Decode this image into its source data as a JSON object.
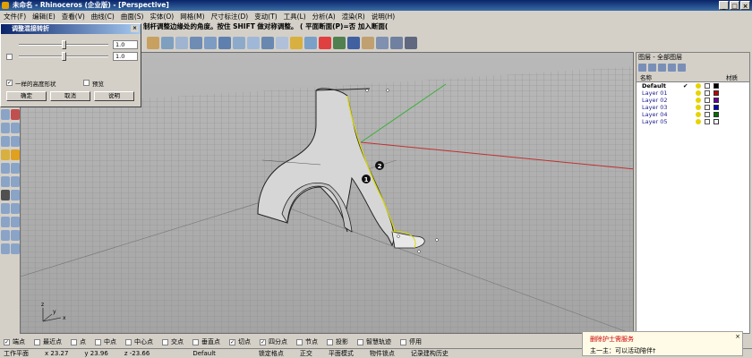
{
  "window": {
    "title": "未命名 - Rhinoceros (企业版) - [Perspective]",
    "buttons": [
      "_",
      "□",
      "×"
    ]
  },
  "menu": {
    "items": [
      "文件(F)",
      "编辑(E)",
      "查看(V)",
      "曲线(C)",
      "曲面(S)",
      "实体(O)",
      "网格(M)",
      "尺寸标注(D)",
      "变动(T)",
      "工具(L)",
      "分析(A)",
      "渲染(R)",
      "说明(H)"
    ]
  },
  "command": {
    "prompt": "制杆调整边缘处的角度。按住 SHIFT 做对称调整。 ( 平面断面(P)=否  加入断面("
  },
  "dialog": {
    "title": "调整混接转折",
    "value1": "1.0",
    "value2": "1.0",
    "same_shape_label": "一样的高度形状",
    "preview_label": "预览",
    "ok_label": "确定",
    "cancel_label": "取消",
    "help_label": "说明",
    "same_shape_checked": true,
    "preview_checked": false
  },
  "viewport": {
    "name": "Perspective",
    "marker1": "1",
    "marker2": "2",
    "axis_x": "x",
    "axis_y": "y",
    "axis_z": "z"
  },
  "layers_panel": {
    "title": "图层 - 全部图层",
    "col_name": "名称",
    "col_material": "材质",
    "rows": [
      {
        "name": "Default",
        "current": "✔",
        "color": "#000000"
      },
      {
        "name": "Layer 01",
        "current": "",
        "color": "#c00000"
      },
      {
        "name": "Layer 02",
        "current": "",
        "color": "#6a00a0"
      },
      {
        "name": "Layer 03",
        "current": "",
        "color": "#0000c0"
      },
      {
        "name": "Layer 04",
        "current": "",
        "color": "#007000"
      },
      {
        "name": "Layer 05",
        "current": "",
        "color": "#ffffff"
      }
    ]
  },
  "osnap": {
    "items": [
      {
        "label": "端点",
        "checked": true
      },
      {
        "label": "最近点",
        "checked": false
      },
      {
        "label": "点",
        "checked": false
      },
      {
        "label": "中点",
        "checked": false
      },
      {
        "label": "中心点",
        "checked": false
      },
      {
        "label": "交点",
        "checked": false
      },
      {
        "label": "垂直点",
        "checked": false
      },
      {
        "label": "切点",
        "checked": true
      },
      {
        "label": "四分点",
        "checked": true
      },
      {
        "label": "节点",
        "checked": false
      },
      {
        "label": "投影",
        "checked": false
      },
      {
        "label": "智慧轨迹",
        "checked": false
      },
      {
        "label": "停用",
        "checked": false
      }
    ]
  },
  "status": {
    "plane": "工作平面",
    "x": "x 23.27",
    "y": "y 23.96",
    "z": "z -23.66",
    "layer": "Default",
    "lock_grid": "锁定格点",
    "ortho": "正交",
    "planar": "平面模式",
    "osnap": "物件锁点",
    "history": "记录建构历史"
  },
  "popup": {
    "title": "删除护士需服务",
    "body": "主一主：可以活动陪伴†"
  }
}
